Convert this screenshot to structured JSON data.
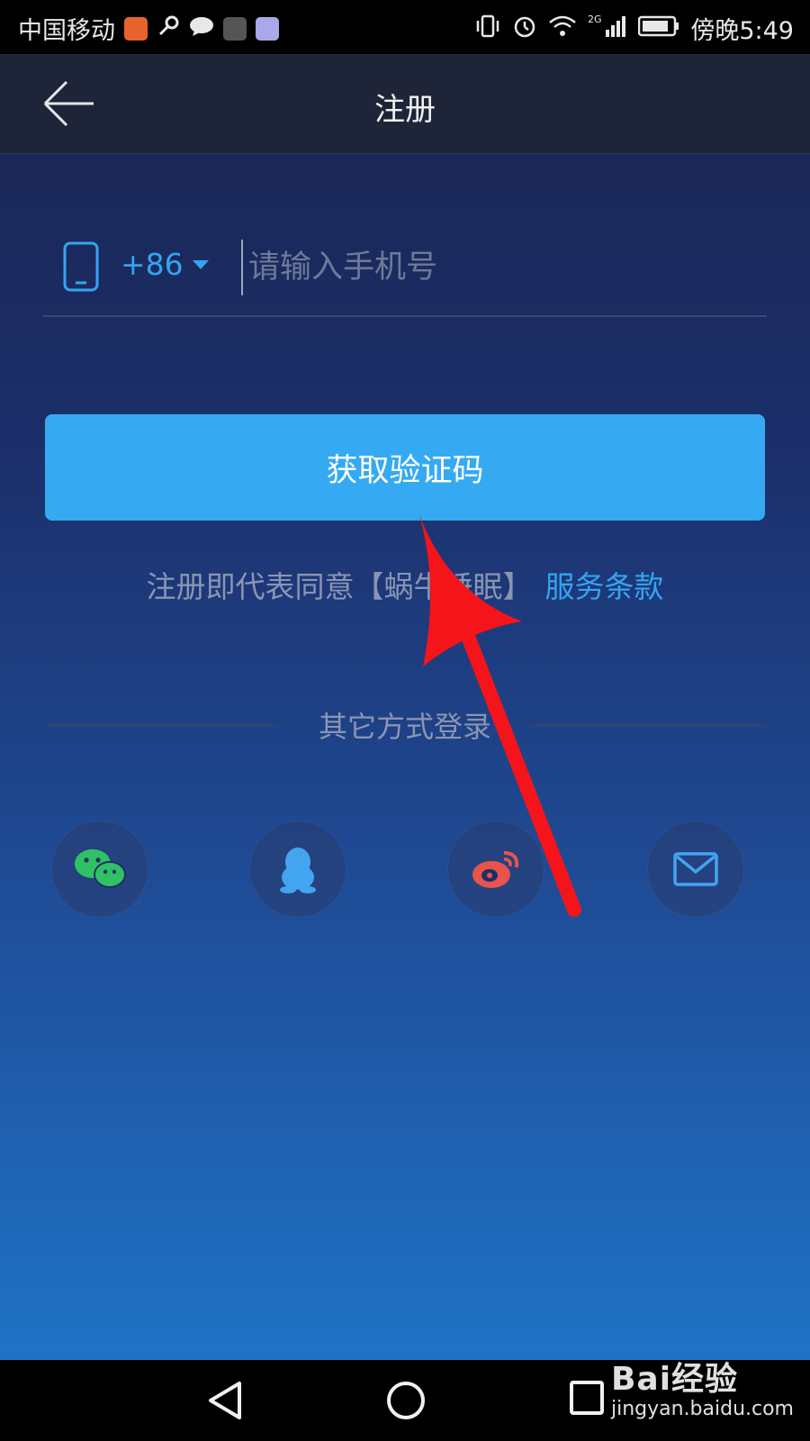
{
  "status_bar": {
    "carrier": "中国移动",
    "network": "2G",
    "time": "傍晚5:49"
  },
  "header": {
    "title": "注册"
  },
  "phone_form": {
    "country_code": "+86",
    "phone_placeholder": "请输入手机号"
  },
  "get_code_button": {
    "label": "获取验证码"
  },
  "terms": {
    "prefix": "注册即代表同意【蜗牛",
    "hidden_part": "睡眠",
    "suffix": "】",
    "link": "服务条款"
  },
  "other_login": {
    "label": "其它方式登录",
    "methods": [
      "wechat",
      "qq",
      "weibo",
      "email"
    ]
  },
  "colors": {
    "accent": "#35aaf2",
    "link": "#34a4f0",
    "muted_text": "#8a95b2",
    "annotation_arrow": "#f5141a"
  },
  "watermark": {
    "brand": "Bai经验",
    "url": "jingyan.baidu.com"
  }
}
